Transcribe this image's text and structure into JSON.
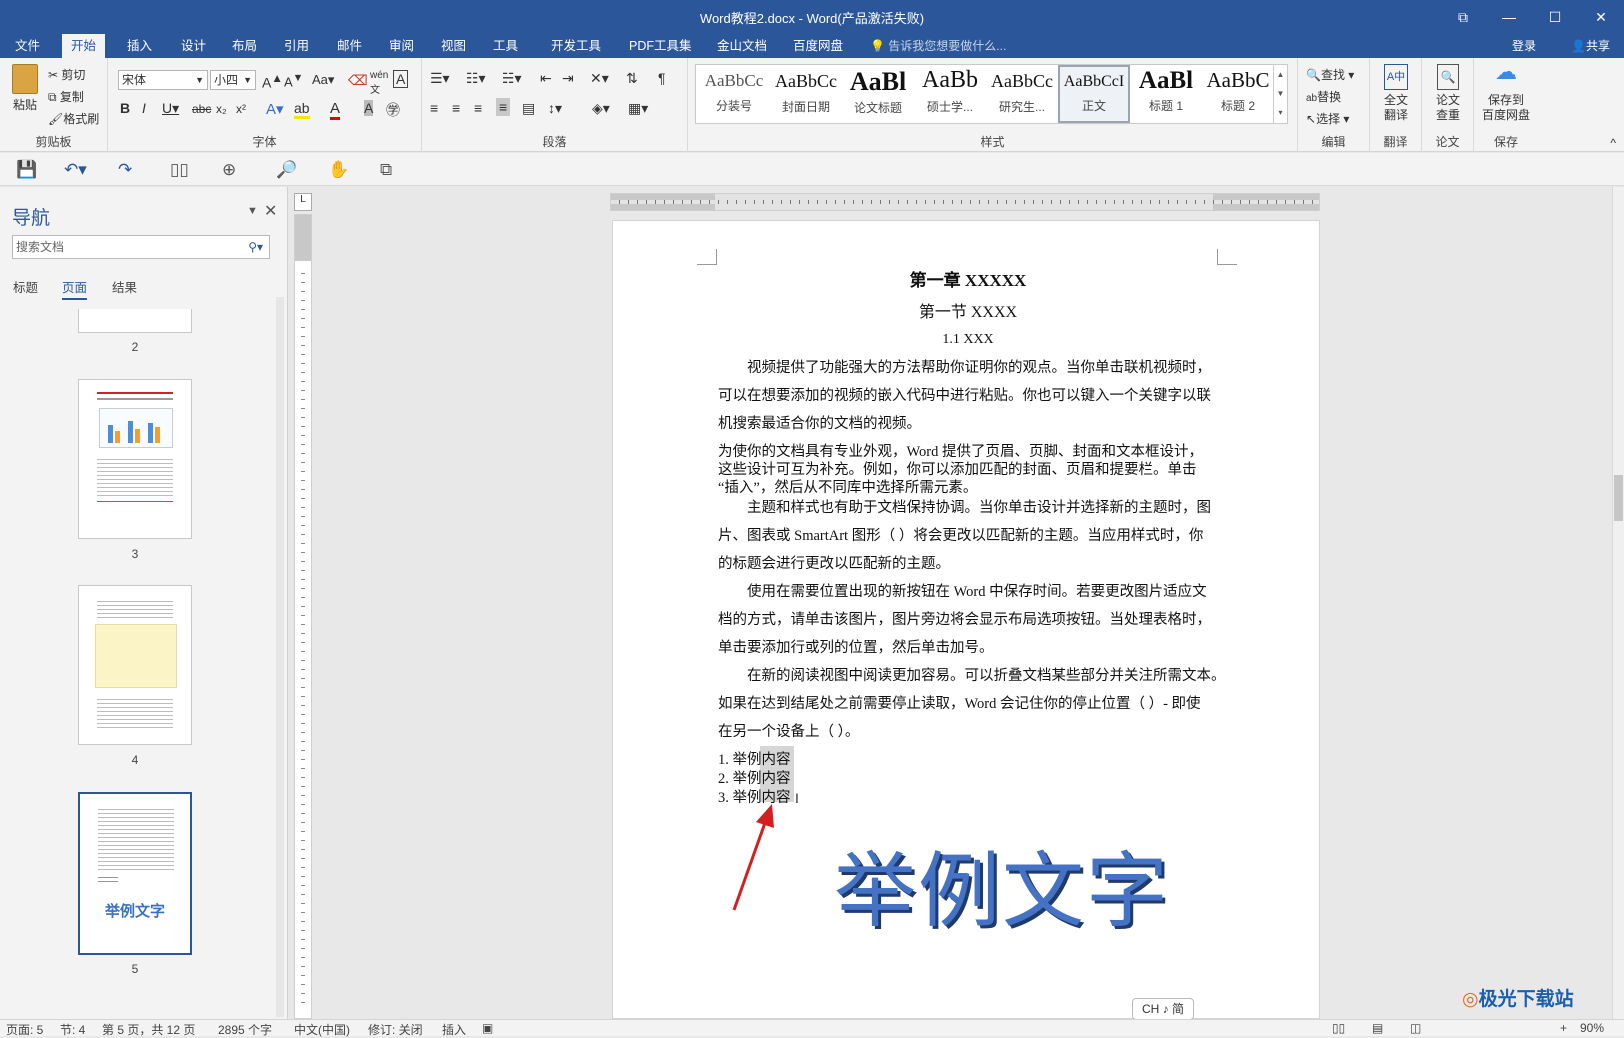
{
  "window": {
    "title": "Word教程2.docx - Word(产品激活失败)"
  },
  "tabs": [
    "文件",
    "开始",
    "插入",
    "设计",
    "布局",
    "引用",
    "邮件",
    "审阅",
    "视图",
    "工具",
    "开发工具",
    "PDF工具集",
    "金山文档",
    "百度网盘"
  ],
  "tell_me": "告诉我您想要做什么...",
  "login": "登录",
  "share": "共享",
  "ribbon": {
    "clipboard": {
      "paste": "粘贴",
      "cut": "剪切",
      "copy": "复制",
      "format_painter": "格式刷",
      "label": "剪贴板"
    },
    "font": {
      "name": "宋体",
      "size": "小四",
      "label": "字体"
    },
    "paragraph": {
      "label": "段落"
    },
    "styles": {
      "label": "样式",
      "items": [
        {
          "preview": "AaBbCc",
          "name": "分装号"
        },
        {
          "preview": "AaBbCc",
          "name": "封面日期"
        },
        {
          "preview": "AaBl",
          "name": "论文标题"
        },
        {
          "preview": "AaBb",
          "name": "硕士学..."
        },
        {
          "preview": "AaBbCc",
          "name": "研究生..."
        },
        {
          "preview": "AaBbCcI",
          "name": "正文"
        },
        {
          "preview": "AaBl",
          "name": "标题 1"
        },
        {
          "preview": "AaBbC",
          "name": "标题 2"
        }
      ]
    },
    "editing": {
      "find": "查找",
      "replace": "替换",
      "select": "选择",
      "label": "编辑"
    },
    "translate": {
      "btn": "全文\n翻译",
      "label": "翻译"
    },
    "paper": {
      "btn": "论文\n查重",
      "label": "论文"
    },
    "save": {
      "btn": "保存到\n百度网盘",
      "label": "保存"
    }
  },
  "nav": {
    "title": "导航",
    "search_placeholder": "搜索文档",
    "tabs": [
      "标题",
      "页面",
      "结果"
    ],
    "pages": [
      "2",
      "3",
      "4",
      "5"
    ],
    "thumb5_text": "举例文字"
  },
  "doc": {
    "chapter": "第一章 XXXXX",
    "section": "第一节 XXXX",
    "subsection": "1.1 XXX",
    "lines": [
      "　　视频提供了功能强大的方法帮助你证明你的观点。当你单击联机视频时，",
      "可以在想要添加的视频的嵌入代码中进行粘贴。你也可以键入一个关键字以联",
      "机搜索最适合你的文档的视频。",
      "为使你的文档具有专业外观，Word 提供了页眉、页脚、封面和文本框设计，",
      "这些设计可互为补充。例如，你可以添加匹配的封面、页眉和提要栏。单击",
      "“插入”，然后从不同库中选择所需元素。",
      "　　主题和样式也有助于文档保持协调。当你单击设计并选择新的主题时，图",
      "片、图表或 SmartArt 图形（  ）将会更改以匹配新的主题。当应用样式时，你",
      "的标题会进行更改以匹配新的主题。",
      "　　使用在需要位置出现的新按钮在 Word 中保存时间。若要更改图片适应文",
      "档的方式，请单击该图片，图片旁边将会显示布局选项按钮。当处理表格时，",
      "单击要添加行或列的位置，然后单击加号。",
      "　　在新的阅读视图中阅读更加容易。可以折叠文档某些部分并关注所需文本。",
      "如果在达到结尾处之前需要停止读取，Word 会记住你的停止位置（  ）- 即使",
      "在另一个设备上（  ）。"
    ],
    "list": [
      "1. 举例内容",
      "2. 举例内容",
      "3. 举例内容"
    ],
    "wordart": "举例文字"
  },
  "status": {
    "page": "页面: 5",
    "section": "节: 4",
    "pages": "第 5 页，共 12 页",
    "words": "2895 个字",
    "lang": "中文(中国)",
    "track": "修订: 关闭",
    "mode": "插入",
    "zoom": "90%"
  },
  "ime": "CH ♪ 简",
  "watermark": "极光下载站"
}
